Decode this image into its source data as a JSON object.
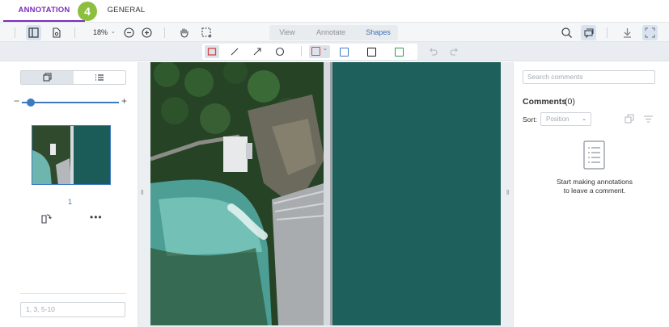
{
  "tabs": {
    "annotation": "ANNOTATION",
    "general": "GENERAL"
  },
  "step_badge": "4",
  "toolbar": {
    "zoom_value": "18%",
    "modes": {
      "view": "View",
      "annotate": "Annotate",
      "shapes": "Shapes"
    },
    "active_mode": "Shapes"
  },
  "shapes_toolbar": {
    "tools": [
      "rectangle-tool",
      "line-tool",
      "arrow-tool",
      "ellipse-tool"
    ],
    "swatch_colors": [
      "#d64545",
      "#3e7ac0",
      "#1a1a1a",
      "#2e9a4a"
    ]
  },
  "left_panel": {
    "page_number": "1",
    "page_range_placeholder": "1, 3, 5-10"
  },
  "right_panel": {
    "search_placeholder": "Search comments",
    "comments_title": "Comments",
    "comments_count": "(0)",
    "sort_label": "Sort:",
    "sort_value": "Position",
    "empty_message_line1": "Start making annotations",
    "empty_message_line2": "to leave a comment."
  },
  "colors": {
    "accent_purple": "#7b2bbd",
    "accent_blue": "#3e7ac0",
    "badge_green": "#8dbf3f"
  }
}
